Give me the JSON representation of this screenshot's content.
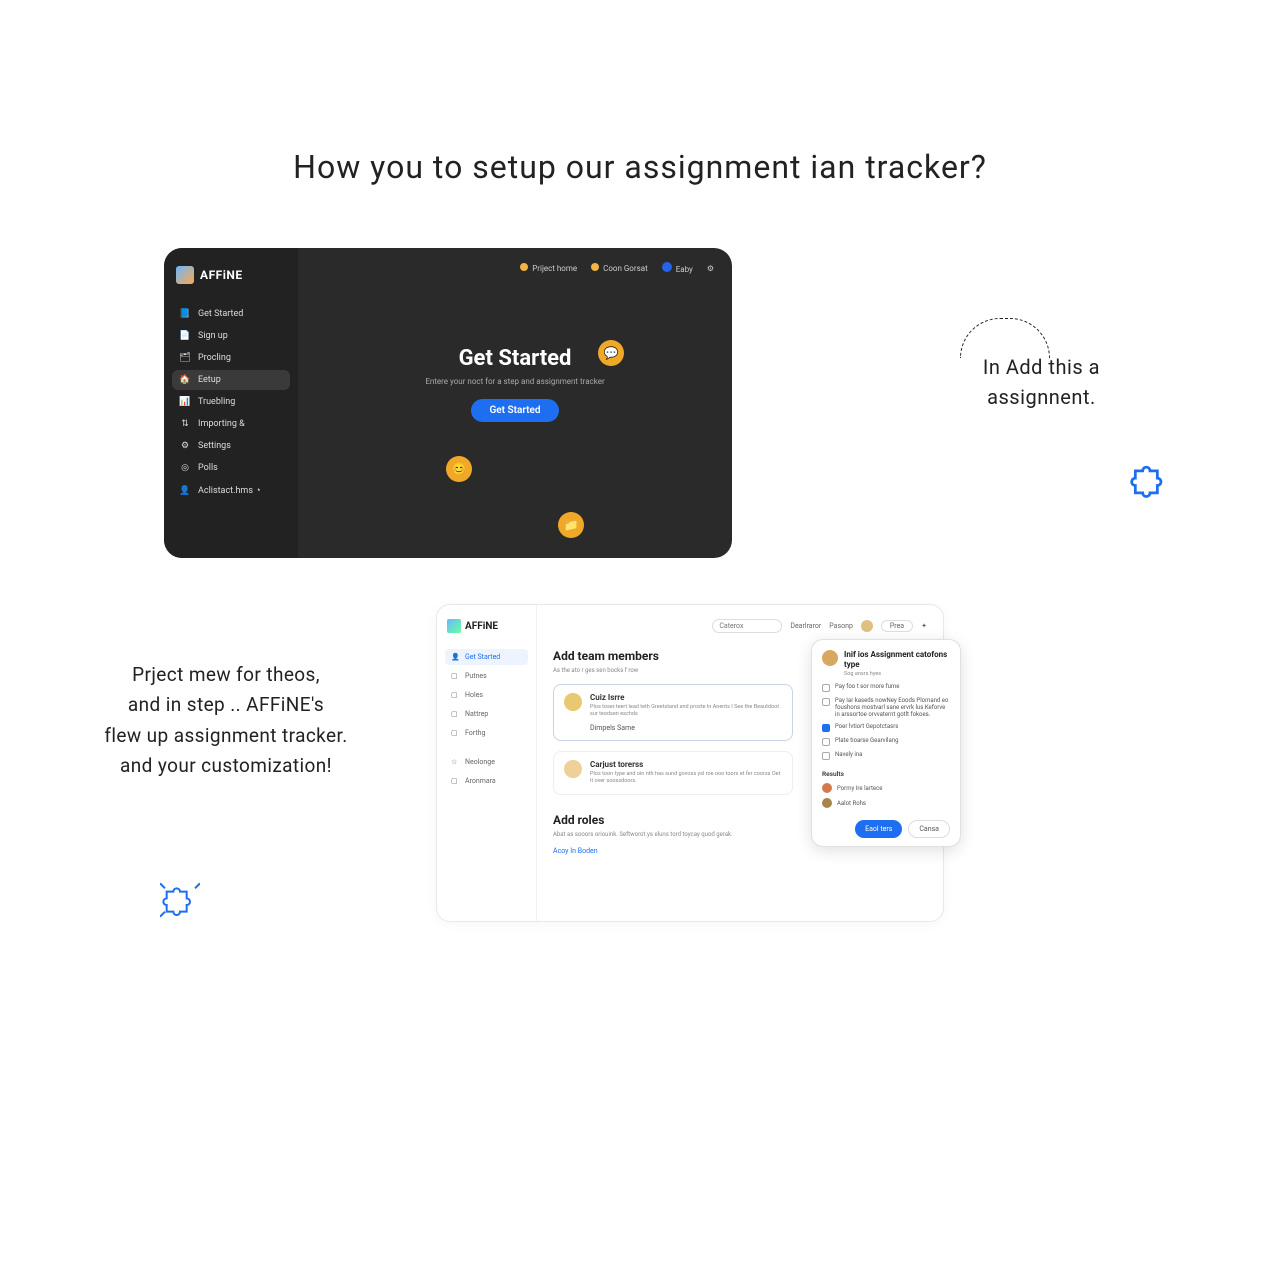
{
  "title": "How you to setup our assignment ian tracker?",
  "annotation_right": {
    "line1": "In  Add this  a",
    "line2": "assignnent."
  },
  "annotation_left": {
    "line1": "Prject mew for theos,",
    "line2": "and in step .. AFFiNE's",
    "line3": "flew up assignment tracker.",
    "line4": "and your customization!"
  },
  "dark": {
    "brand": "AFFiNE",
    "nav": [
      {
        "label": "Get Started",
        "icon": "📘"
      },
      {
        "label": "Sign up",
        "icon": "📄"
      },
      {
        "label": "Procling",
        "icon": "🗂"
      },
      {
        "label": "Eetup",
        "icon": "🏠"
      },
      {
        "label": "Truebling",
        "icon": "📊"
      },
      {
        "label": "Importing &",
        "icon": "⇅"
      },
      {
        "label": "Settings",
        "icon": "⚙"
      },
      {
        "label": "Polls",
        "icon": "◎"
      },
      {
        "label": "Aclistact.hms ◔",
        "icon": "👤"
      }
    ],
    "topnav": {
      "item1": "Priject home",
      "item2": "Сoon Gorsat",
      "item3": "Eaby",
      "gear": "⚙"
    },
    "hero": {
      "heading": "Get Started",
      "sub": "Entere your noct for a step and assignment tracker",
      "button": "Get Started"
    }
  },
  "light": {
    "brand": "AFFiNE",
    "nav": [
      {
        "label": "Get Started"
      },
      {
        "label": "Putnes"
      },
      {
        "label": "Holes"
      },
      {
        "label": "Nattrep"
      },
      {
        "label": "Forthg"
      },
      {
        "label": "Neolonge"
      },
      {
        "label": "Aronmara"
      }
    ],
    "topbar": {
      "search_placeholder": "Caterox",
      "item2": "Dearlraror",
      "item3": "Pasonp",
      "badge": "Prea"
    },
    "section_members": {
      "title": "Add team members",
      "sub": "As the ato r ges sen bocks f row",
      "card1": {
        "name": "Cuiz Isrre",
        "desc": "Plos toser.teert lead teth Greetstand and proste ln Anents I See the Beautdoot sur teodsen eschds",
        "link": "Dimpels Same"
      },
      "card2": {
        "name": "Carjust torerss",
        "desc": "Plos toon type and oin nth has sund govoss ysl roe ooo toors et fer coorss Oet it over soossdoors."
      }
    },
    "section_roles": {
      "title": "Add roles",
      "sub": "Abat as sooors oriouink. Seftworot.ys eluns tord toycay quod gerak.",
      "link": "Acoy In Boden"
    },
    "panel": {
      "title": "Inif ios Assignment catofons type",
      "sub": "Sog ansrs hyes",
      "opt1": "Pay foo t sor more fume",
      "opt2": "Pay Iar kaseds nowNey Eoods Plomand eo foushons mostvarl sane ervrk lus Keforve in arssortoe orvvaternt gotlt fokoes.",
      "opt3": "Poer lvtiort Gepotctasrs",
      "opt4": "Plate tioarse Gearvilang",
      "opt5": "Navely ina",
      "section_results": "Results",
      "user1": "Pormy Ire lartece",
      "user2": "Aalot Rohs",
      "btn_primary": "Eaol ters",
      "btn_secondary": "Cansa"
    }
  }
}
